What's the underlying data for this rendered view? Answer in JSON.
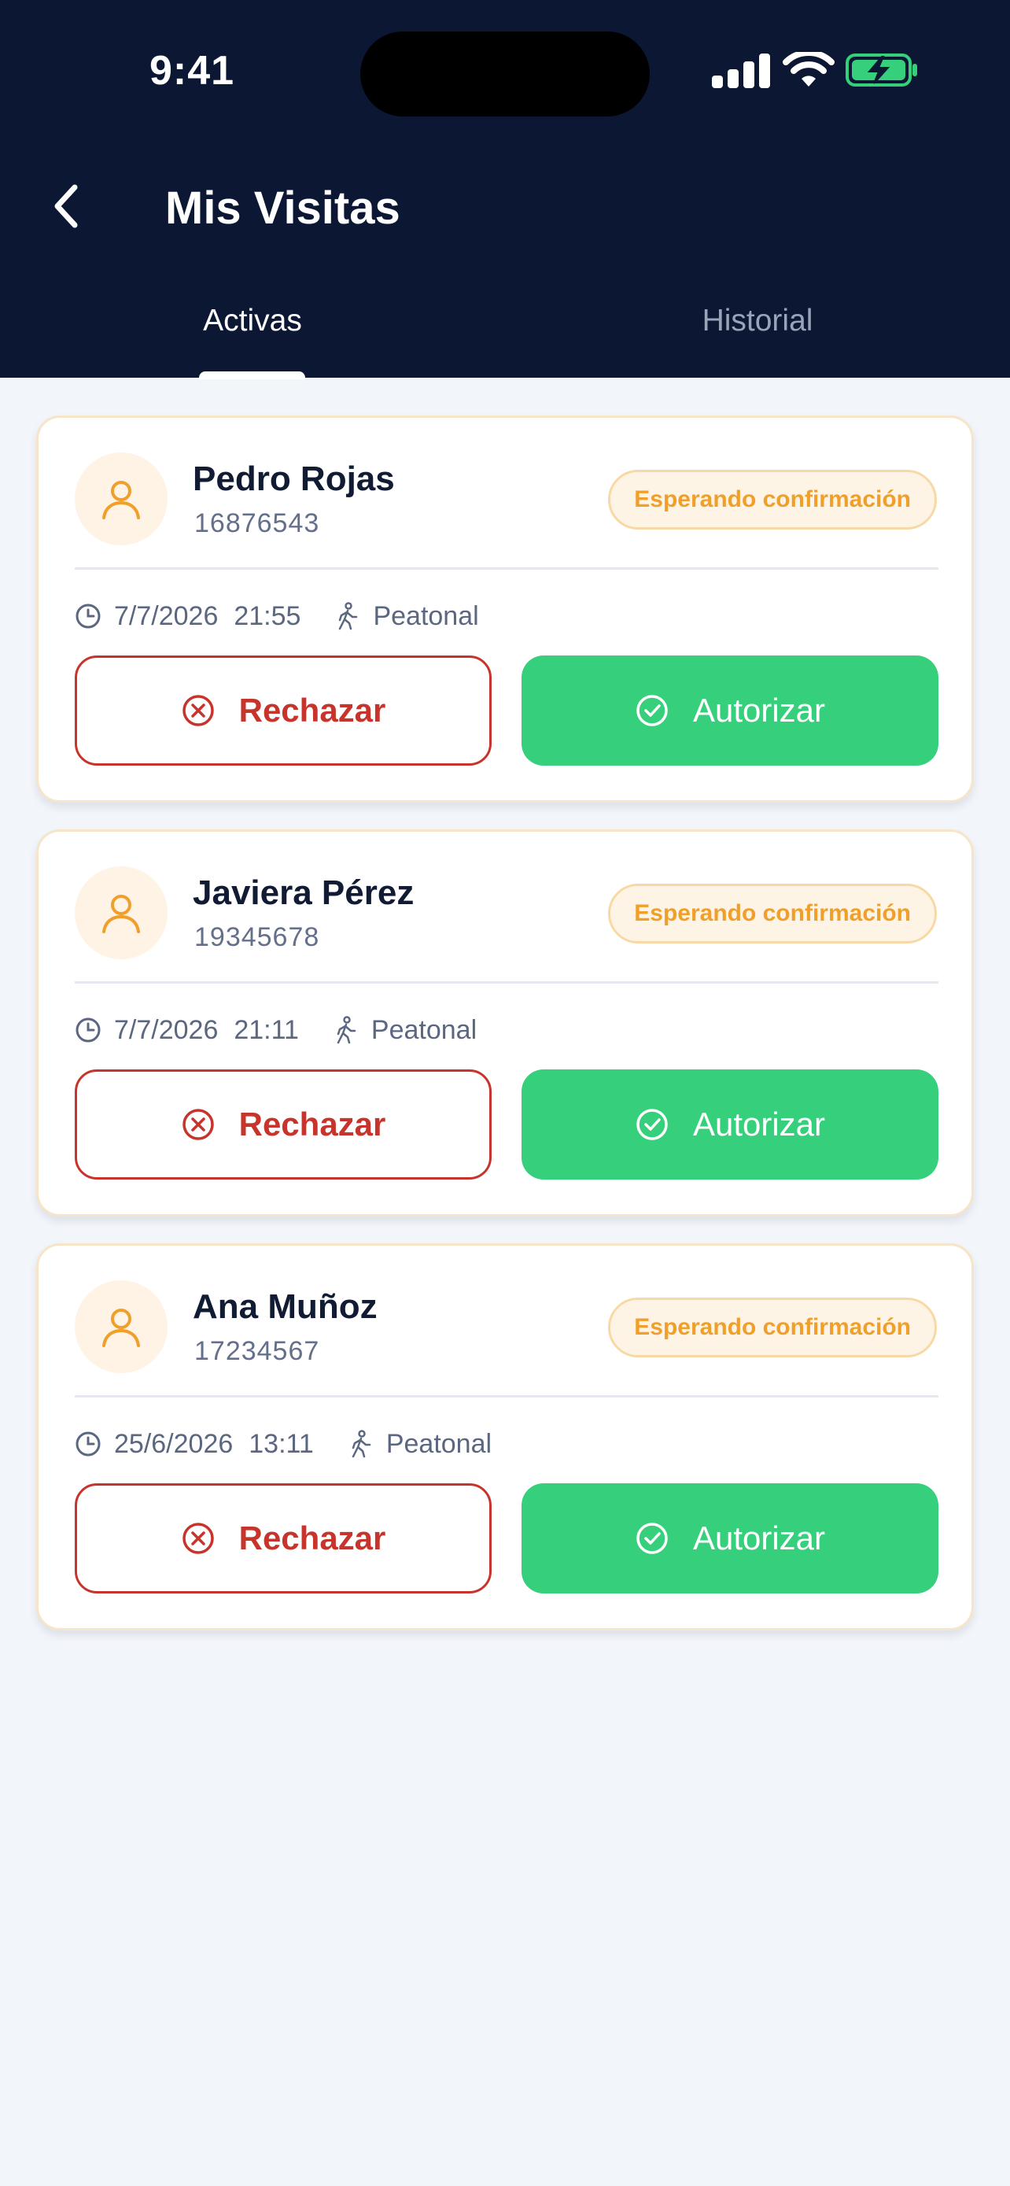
{
  "status_bar": {
    "time": "9:41",
    "icons": [
      "cellular-signal-icon",
      "wifi-icon",
      "battery-charging-icon"
    ],
    "battery_color": "#36d07c"
  },
  "header": {
    "title": "Mis Visitas",
    "back_icon": "chevron-left-icon",
    "background": "#0b1733"
  },
  "tabs": [
    {
      "label": "Activas",
      "active": true
    },
    {
      "label": "Historial",
      "active": false
    }
  ],
  "visits": [
    {
      "name": "Pedro Rojas",
      "rut": "16876543",
      "status": "Esperando confirmación",
      "date": "7/7/2026",
      "time": "21:55",
      "type": "Peatonal",
      "reject_label": "Rechazar",
      "authorize_label": "Autorizar"
    },
    {
      "name": "Javiera Pérez",
      "rut": "19345678",
      "status": "Esperando confirmación",
      "date": "7/7/2026",
      "time": "21:11",
      "type": "Peatonal",
      "reject_label": "Rechazar",
      "authorize_label": "Autorizar"
    },
    {
      "name": "Ana Muñoz",
      "rut": "17234567",
      "status": "Esperando confirmación",
      "date": "25/6/2026",
      "time": "13:11",
      "type": "Peatonal",
      "reject_label": "Rechazar",
      "authorize_label": "Autorizar"
    }
  ],
  "colors": {
    "accent_green": "#36d07c",
    "reject_red": "#c7342b",
    "pending_orange": "#f0a02a",
    "page_background": "#f2f5fa"
  }
}
